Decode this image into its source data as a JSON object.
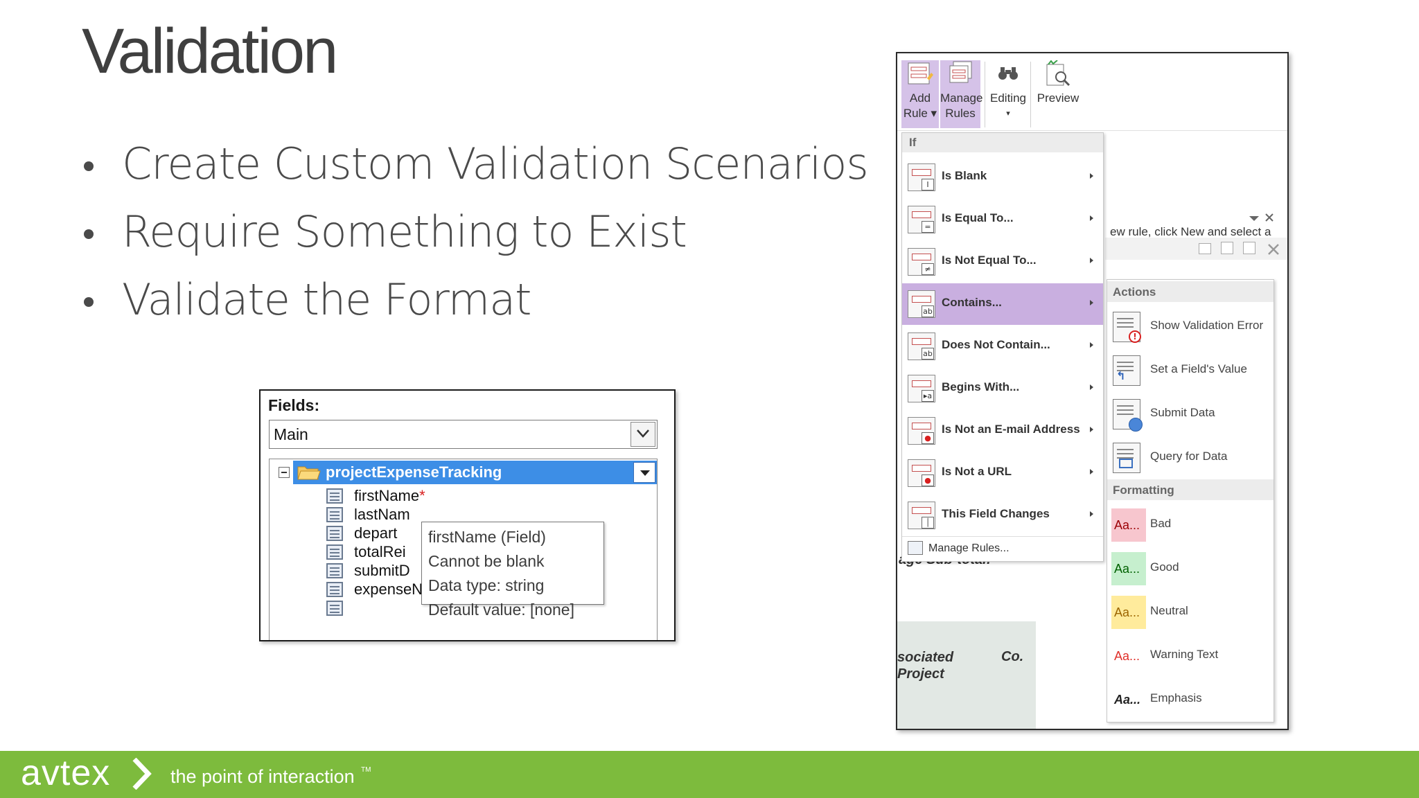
{
  "slide": {
    "title": "Validation",
    "bullets": [
      "Create Custom Validation Scenarios",
      "Require Something to Exist",
      "Validate the Format"
    ]
  },
  "fields_panel": {
    "label": "Fields:",
    "datasource": "Main",
    "root": "projectExpenseTracking",
    "fields": [
      {
        "name": "firstName",
        "required_mark": "*"
      },
      {
        "name": "lastNam",
        "required_mark": ""
      },
      {
        "name": "depart",
        "required_mark": ""
      },
      {
        "name": "totalRei",
        "required_mark": ""
      },
      {
        "name": "submitD",
        "required_mark": ""
      },
      {
        "name": "expenseNotes",
        "required_mark": ""
      }
    ],
    "tooltip": [
      "firstName (Field)",
      "Cannot be blank",
      "Data type: string",
      "Default value: [none]"
    ]
  },
  "ribbon": {
    "add_rule": [
      "Add",
      "Rule ▾"
    ],
    "manage_rules": [
      "Manage",
      "Rules"
    ],
    "editing": [
      "Editing",
      "▾"
    ],
    "preview": [
      "Preview"
    ]
  },
  "background": {
    "hint": "ew rule, click New and select a",
    "sub_total": "age Sub-total:",
    "assoc": [
      "sociated",
      "Project"
    ],
    "co": "Co."
  },
  "if_menu": {
    "header": "If",
    "items": [
      {
        "label": "Is Blank",
        "sym": "I"
      },
      {
        "label": "Is Equal To...",
        "sym": "="
      },
      {
        "label": "Is Not Equal To...",
        "sym": "≠"
      },
      {
        "label": "Contains...",
        "sym": "ab"
      },
      {
        "label": "Does Not Contain...",
        "sym": "ab"
      },
      {
        "label": "Begins With...",
        "sym": "▸a"
      },
      {
        "label": "Is Not an E-mail Address",
        "sym": "●"
      },
      {
        "label": "Is Not a URL",
        "sym": "●"
      },
      {
        "label": "This Field Changes",
        "sym": "│"
      }
    ],
    "manage": "Manage Rules..."
  },
  "actions_menu": {
    "actions_header": "Actions",
    "actions": [
      "Show Validation Error",
      "Set a Field's Value",
      "Submit Data",
      "Query for Data"
    ],
    "formatting_header": "Formatting",
    "formats": [
      {
        "label": "Bad",
        "sample": "Aa...",
        "bg": "#f7c6ce",
        "fg": "#9c0006"
      },
      {
        "label": "Good",
        "sample": "Aa...",
        "bg": "#c6efce",
        "fg": "#006100"
      },
      {
        "label": "Neutral",
        "sample": "Aa...",
        "bg": "#ffeb9c",
        "fg": "#9c6500"
      },
      {
        "label": "Warning Text",
        "sample": "Aa...",
        "bg": "#ffffff",
        "fg": "#e0302a"
      },
      {
        "label": "Emphasis",
        "sample": "Aa...",
        "bg": "#ffffff",
        "fg": "#222222"
      }
    ]
  },
  "footer": {
    "brand": "avtex",
    "tagline": "the point of interaction",
    "tm": "TM",
    "color": "#7dbb3d"
  },
  "colors": {
    "menu_highlight": "#c9afe0",
    "tree_selection": "#3d8ee6"
  }
}
